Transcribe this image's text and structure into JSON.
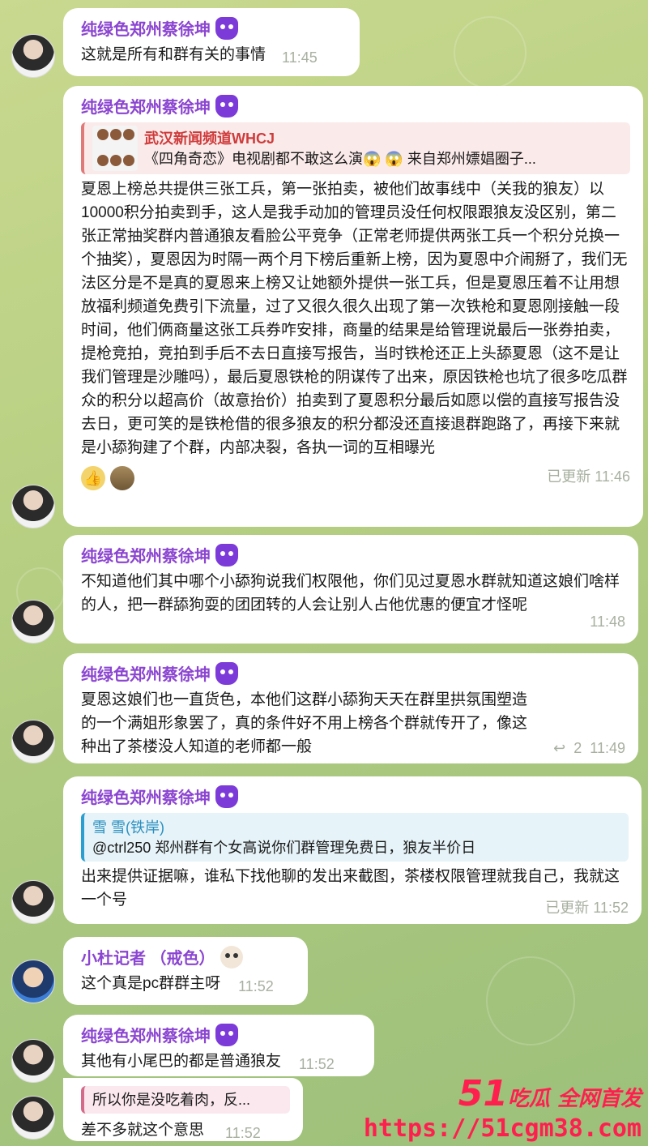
{
  "messages": [
    {
      "sender": "纯绿色郑州蔡徐坤",
      "text": "这就是所有和群有关的事情",
      "time": "11:45"
    },
    {
      "sender": "纯绿色郑州蔡徐坤",
      "quote": {
        "title": "武汉新闻频道WHCJ",
        "body": "《四角奇恋》电视剧都不敢这么演😱 😱 来自郑州嫖娼圈子..."
      },
      "text": "夏恩上榜总共提供三张工兵，第一张拍卖，被他们故事线中（关我的狼友）以10000积分拍卖到手，这人是我手动加的管理员没任何权限跟狼友没区别，第二张正常抽奖群内普通狼友看脸公平竞争（正常老师提供两张工兵一个积分兑换一个抽奖），夏恩因为时隔一两个月下榜后重新上榜，因为夏恩中介闹掰了，我们无法区分是不是真的夏恩来上榜又让她额外提供一张工兵，但是夏恩压着不让用想放福利频道免费引下流量，过了又很久很久出现了第一次铁枪和夏恩刚接触一段时间，他们俩商量这张工兵券咋安排，商量的结果是给管理说最后一张券拍卖，提枪竞拍，竞拍到手后不去日直接写报告，当时铁枪还正上头舔夏恩（这不是让我们管理是沙雕吗），最后夏恩铁枪的阴谋传了出来，原因铁枪也坑了很多吃瓜群众的积分以超高价（故意抬价）拍卖到了夏恩积分最后如愿以偿的直接写报告没去日，更可笑的是铁枪借的很多狼友的积分都没还直接退群跑路了，再接下来就是小舔狗建了个群，内部决裂，各执一词的互相曝光",
      "reactions": [
        "👍",
        "photo"
      ],
      "time": "已更新 11:46"
    },
    {
      "sender": "纯绿色郑州蔡徐坤",
      "text": "不知道他们其中哪个小舔狗说我们权限他，你们见过夏恩水群就知道这娘们啥样的人，把一群舔狗耍的团团转的人会让别人占他优惠的便宜才怪呢",
      "time": "11:48"
    },
    {
      "sender": "纯绿色郑州蔡徐坤",
      "text": "夏恩这娘们也一直货色，本他们这群小舔狗天天在群里拱氛围塑造的一个满姐形象罢了，真的条件好不用上榜各个群就传开了，像这种出了茶楼没人知道的老师都一般",
      "reply_count": "2",
      "time": "11:49"
    },
    {
      "sender": "纯绿色郑州蔡徐坤",
      "quote": {
        "title": "雪 雪(铁岸)",
        "body": "@ctrl250 郑州群有个女高说你们群管理免费日，狼友半价日"
      },
      "text": "出来提供证据嘛，谁私下找他聊的发出来截图，茶楼权限管理就我自己，我就这一个号",
      "time": "已更新 11:52"
    },
    {
      "sender": "小杜记者 （戒色）",
      "text": "这个真是pc群群主呀",
      "time": "11:52"
    },
    {
      "sender": "纯绿色郑州蔡徐坤",
      "text": "其他有小尾巴的都是普通狼友",
      "time": "11:52"
    },
    {
      "quote": {
        "body": "所以你是没吃着肉，反..."
      },
      "text": "差不多就这个意思",
      "time": "11:52"
    }
  ],
  "watermark": {
    "brand_num": "51",
    "brand_text": "吃瓜 全网首发",
    "url": "https://51cgm38.com"
  },
  "colors": {
    "sender": "#8b45d1",
    "quote_red": "#cf3b3b",
    "quote_blue": "#2a8fc0",
    "watermark": "#ff1f4f"
  }
}
